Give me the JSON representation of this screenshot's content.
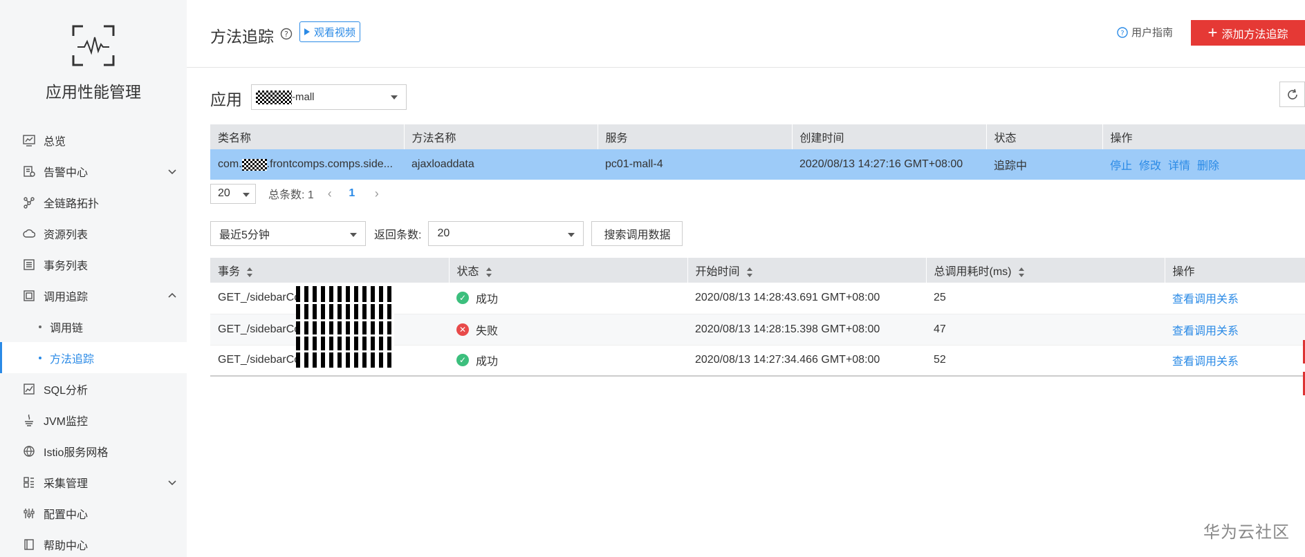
{
  "sidebar": {
    "brand_title": "应用性能管理",
    "items": [
      {
        "label": "总览",
        "icon": "chart-icon"
      },
      {
        "label": "告警中心",
        "icon": "alarm-icon",
        "expandable": true
      },
      {
        "label": "全链路拓扑",
        "icon": "topology-icon"
      },
      {
        "label": "资源列表",
        "icon": "cloud-icon"
      },
      {
        "label": "事务列表",
        "icon": "list-icon"
      },
      {
        "label": "调用追踪",
        "icon": "trace-icon",
        "expanded": true
      },
      {
        "label": "SQL分析",
        "icon": "sql-icon"
      },
      {
        "label": "JVM监控",
        "icon": "java-icon"
      },
      {
        "label": "Istio服务网格",
        "icon": "mesh-icon"
      },
      {
        "label": "采集管理",
        "icon": "collect-icon",
        "expandable": true
      },
      {
        "label": "配置中心",
        "icon": "settings-icon"
      },
      {
        "label": "帮助中心",
        "icon": "help-book-icon"
      }
    ],
    "sub_items": [
      {
        "label": "调用链",
        "active": false
      },
      {
        "label": "方法追踪",
        "active": true
      }
    ]
  },
  "header": {
    "title": "方法追踪",
    "video_label": "观看视频",
    "guide_label": "用户指南",
    "add_label": "添加方法追踪"
  },
  "app": {
    "label": "应用",
    "selected_suffix": "-mall"
  },
  "table1": {
    "columns": [
      "类名称",
      "方法名称",
      "服务",
      "创建时间",
      "状态",
      "操作"
    ],
    "row": {
      "class_prefix": "com.",
      "class_suffix": ".frontcomps.comps.side...",
      "method": "ajaxloaddata",
      "service": "pc01-mall-4",
      "created": "2020/08/13 14:27:16 GMT+08:00",
      "status": "追踪中",
      "actions": [
        "停止",
        "修改",
        "详情",
        "删除"
      ]
    }
  },
  "pager": {
    "page_size": "20",
    "total": "总条数: 1",
    "current_page": "1"
  },
  "filters": {
    "time_range": "最近5分钟",
    "return_label": "返回条数:",
    "return_count": "20",
    "search_label": "搜索调用数据"
  },
  "table2": {
    "columns": [
      "事务",
      "状态",
      "开始时间",
      "总调用耗时(ms)",
      "操作"
    ],
    "rows": [
      {
        "txn": "GET_/sidebarCc",
        "status": "成功",
        "ok": true,
        "start": "2020/08/13 14:28:43.691 GMT+08:00",
        "duration": "25",
        "action": "查看调用关系"
      },
      {
        "txn": "GET_/sidebarCc",
        "status": "失败",
        "ok": false,
        "start": "2020/08/13 14:28:15.398 GMT+08:00",
        "duration": "47",
        "action": "查看调用关系"
      },
      {
        "txn": "GET_/sidebarCc",
        "status": "成功",
        "ok": true,
        "start": "2020/08/13 14:27:34.466 GMT+08:00",
        "duration": "52",
        "action": "查看调用关系"
      }
    ]
  },
  "watermark": "华为云社区",
  "colors": {
    "accent": "#2a8ae6",
    "danger": "#e53935",
    "selected_row": "#9dcbf8",
    "success": "#3cbf7d",
    "error": "#e84a4a"
  }
}
